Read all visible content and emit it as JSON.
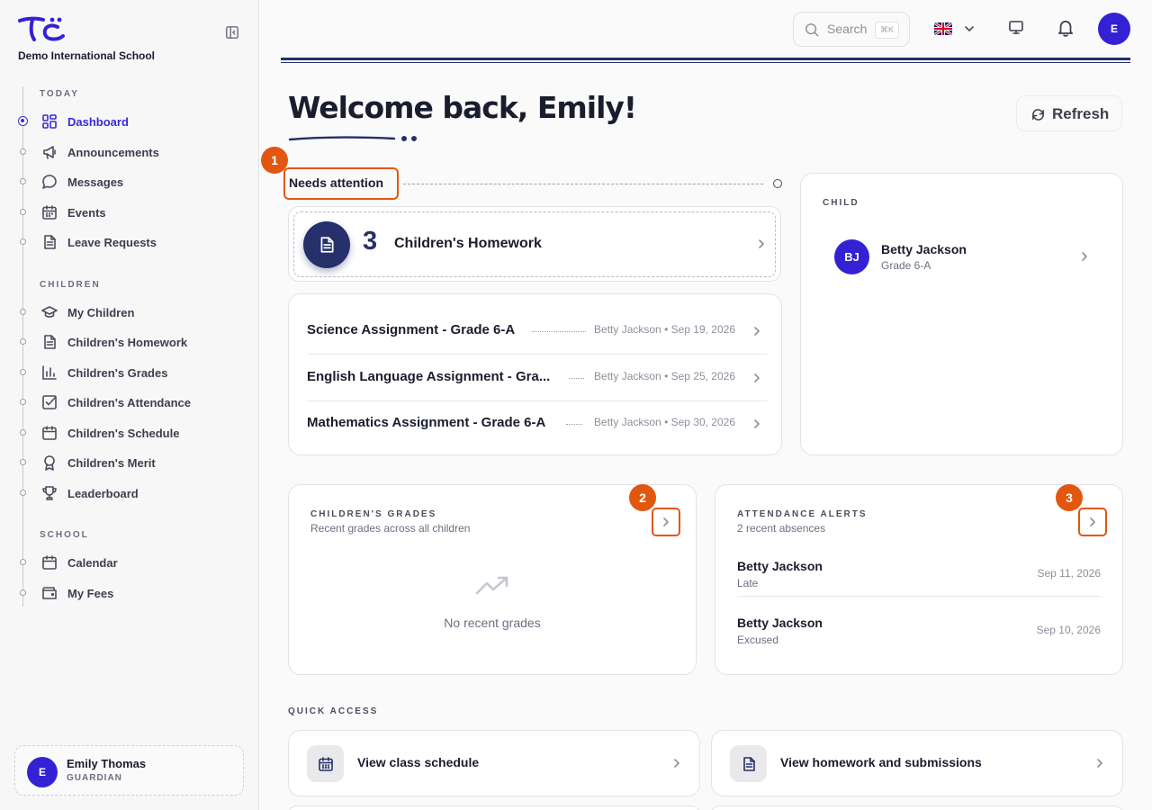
{
  "sidebar": {
    "school_name": "Demo International School",
    "sections": [
      {
        "label": "TODAY",
        "items": [
          {
            "label": "Dashboard",
            "icon": "dashboard-icon",
            "active": true
          },
          {
            "label": "Announcements",
            "icon": "megaphone-icon"
          },
          {
            "label": "Messages",
            "icon": "message-icon"
          },
          {
            "label": "Events",
            "icon": "calendar-icon"
          },
          {
            "label": "Leave Requests",
            "icon": "document-icon"
          }
        ]
      },
      {
        "label": "CHILDREN",
        "items": [
          {
            "label": "My Children",
            "icon": "graduation-cap-icon"
          },
          {
            "label": "Children's Homework",
            "icon": "document-icon"
          },
          {
            "label": "Children's Grades",
            "icon": "bar-chart-icon"
          },
          {
            "label": "Children's Attendance",
            "icon": "checkbox-icon"
          },
          {
            "label": "Children's Schedule",
            "icon": "calendar-icon"
          },
          {
            "label": "Children's Merit",
            "icon": "award-icon"
          },
          {
            "label": "Leaderboard",
            "icon": "trophy-icon"
          }
        ]
      },
      {
        "label": "SCHOOL",
        "items": [
          {
            "label": "Calendar",
            "icon": "calendar-icon"
          },
          {
            "label": "My Fees",
            "icon": "wallet-icon"
          }
        ]
      }
    ],
    "user": {
      "initial": "E",
      "name": "Emily Thomas",
      "role": "GUARDIAN"
    }
  },
  "topbar": {
    "search_placeholder": "Search",
    "search_shortcut": "⌘K",
    "language_icon": "uk-flag-icon",
    "avatar_initial": "E"
  },
  "header": {
    "welcome": "Welcome back, Emily!",
    "refresh_label": "Refresh"
  },
  "needs_attention": {
    "title": "Needs attention",
    "homework_count": "3",
    "homework_label": "Children's Homework",
    "items": [
      {
        "title": "Science Assignment - Grade 6-A",
        "meta": "Betty Jackson • Sep 19, 2026"
      },
      {
        "title": "English Language Assignment - Gra...",
        "meta": "Betty Jackson • Sep 25, 2026"
      },
      {
        "title": "Mathematics Assignment - Grade 6-A",
        "meta": "Betty Jackson • Sep 30, 2026"
      }
    ]
  },
  "child_card": {
    "heading": "CHILD",
    "initials": "BJ",
    "name": "Betty Jackson",
    "grade": "Grade 6-A"
  },
  "grades_card": {
    "heading": "CHILDREN'S GRADES",
    "subtitle": "Recent grades across all children",
    "empty": "No recent grades"
  },
  "attendance_card": {
    "heading": "ATTENDANCE ALERTS",
    "subtitle": "2 recent absences",
    "items": [
      {
        "name": "Betty Jackson",
        "status": "Late",
        "date": "Sep 11, 2026"
      },
      {
        "name": "Betty Jackson",
        "status": "Excused",
        "date": "Sep 10, 2026"
      }
    ]
  },
  "quick_access": {
    "heading": "QUICK ACCESS",
    "tiles": [
      {
        "label": "View class schedule",
        "icon": "calendar-icon"
      },
      {
        "label": "View homework and submissions",
        "icon": "document-icon"
      }
    ]
  },
  "annotations": [
    "1",
    "2",
    "3"
  ],
  "colors": {
    "accent": "#3a2ad8",
    "navy": "#26306a",
    "highlight": "#e2570f"
  }
}
